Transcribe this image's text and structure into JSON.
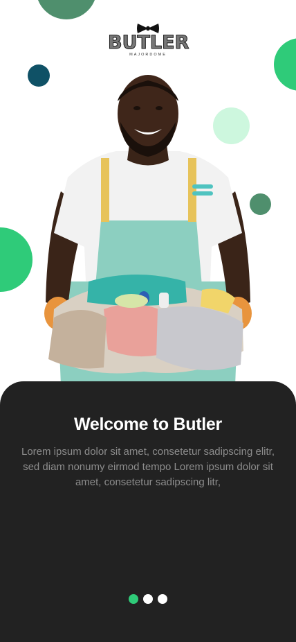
{
  "brand": {
    "name": "BUTLER",
    "tagline": "MAJORDOME"
  },
  "hero": {
    "icon": "person-with-laundry-basket"
  },
  "onboarding": {
    "title": "Welcome to Butler",
    "description": "Lorem ipsum dolor sit amet, consetetur sadipscing elitr, sed diam nonumy eirmod tempo Lorem ipsum dolor sit amet, consetetur sadipscing litr,",
    "page_count": 3,
    "current_page": 1
  },
  "colors": {
    "accent": "#2fcb79",
    "accent_dark": "#4f8f6d",
    "navy": "#0f5166",
    "mint": "#cdf7de",
    "card_bg": "#222222",
    "text_primary": "#ffffff",
    "text_secondary": "#8c8c8c"
  }
}
